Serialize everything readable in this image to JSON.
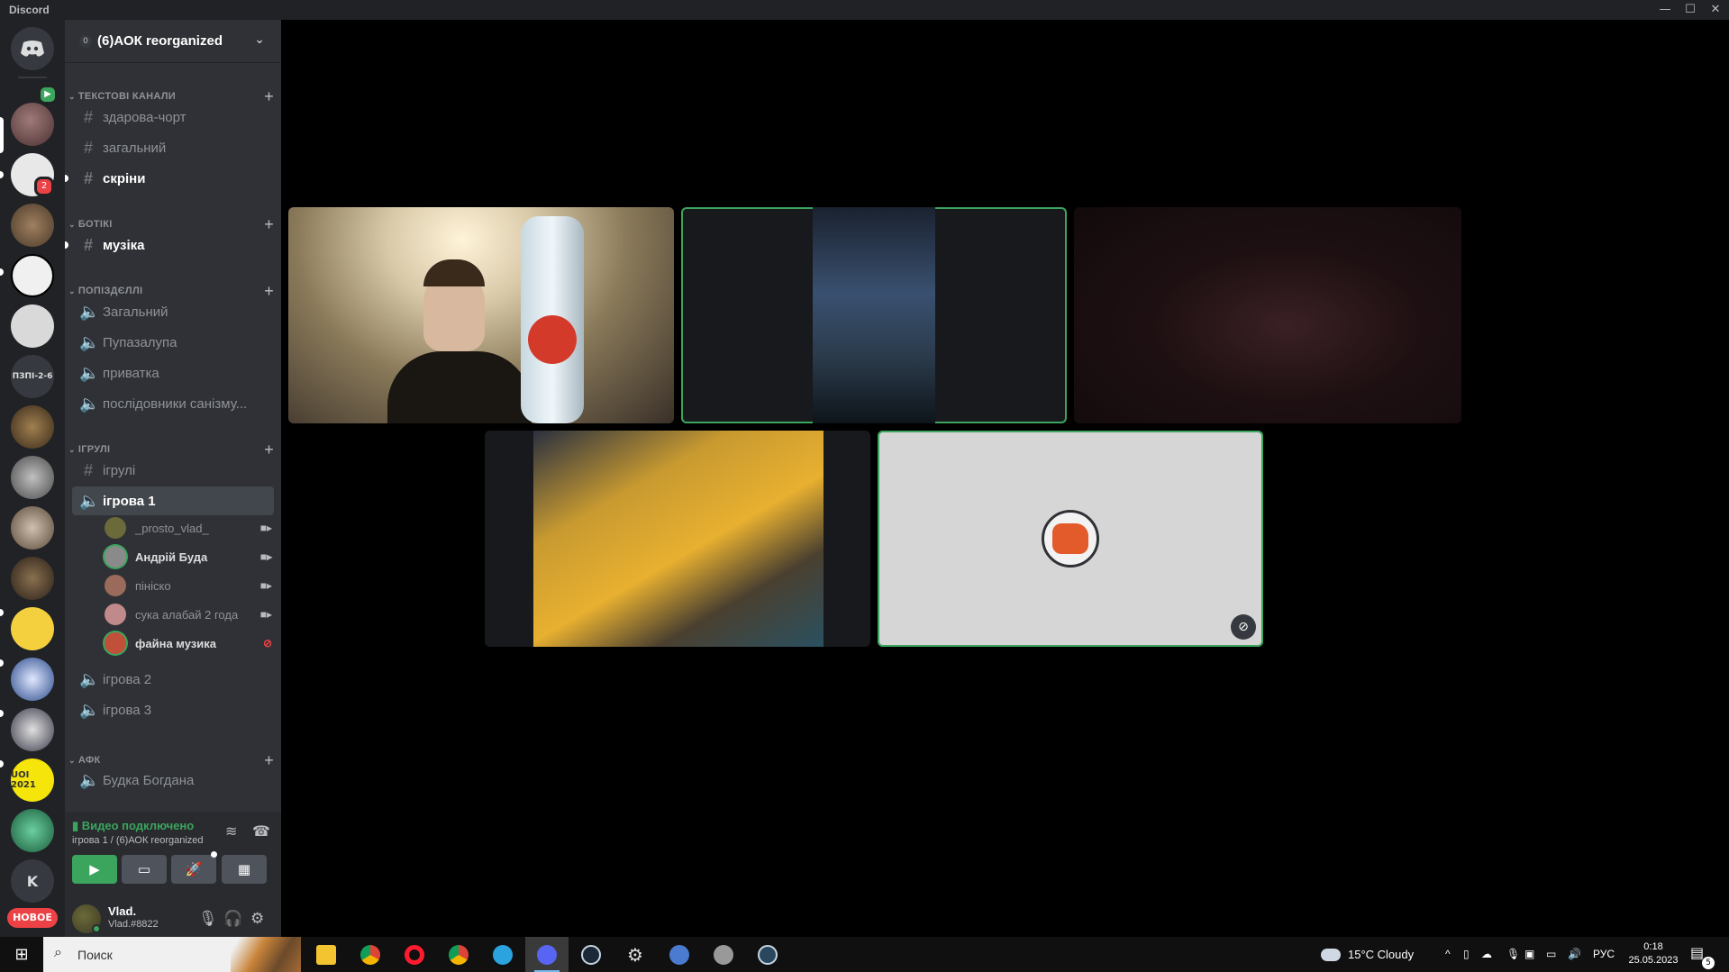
{
  "window": {
    "title": "Discord",
    "minimize": "—",
    "maximize": "☐",
    "close": "✕"
  },
  "guilds": {
    "home_icon": "discord-logo-icon",
    "items": [
      {
        "name": "server-1",
        "color": "#7a5a5a",
        "badge": ""
      },
      {
        "name": "server-2",
        "color": "#e8e8e8",
        "badge": "2"
      },
      {
        "name": "server-3",
        "color": "#7b6650",
        "badge": ""
      },
      {
        "name": "server-4",
        "color": "#f0f0f0",
        "badge": ""
      },
      {
        "name": "server-5",
        "color": "#d9d9d9",
        "badge": ""
      },
      {
        "name": "server-6",
        "text": "ПЗПІ-2-6",
        "color": "#36393f",
        "badge": ""
      },
      {
        "name": "server-7",
        "color": "#6b5a3a",
        "badge": ""
      },
      {
        "name": "server-8",
        "color": "#9a9a9a",
        "badge": ""
      },
      {
        "name": "server-9",
        "color": "#8a7a6a",
        "badge": ""
      },
      {
        "name": "server-10",
        "color": "#5a4a3a",
        "badge": ""
      },
      {
        "name": "server-11",
        "color": "#f4d03f",
        "badge": ""
      },
      {
        "name": "server-12",
        "color": "#2a4a8a",
        "badge": ""
      },
      {
        "name": "server-13",
        "color": "#5a5a6a",
        "badge": ""
      },
      {
        "name": "server-14",
        "text": "UOI 2021",
        "color": "#f5e50a",
        "badge": ""
      },
      {
        "name": "server-15",
        "color": "#2e7d5a",
        "badge": ""
      },
      {
        "name": "server-16",
        "text": "K",
        "color": "#36393f",
        "badge": ""
      }
    ],
    "new_label": "НОВОЕ"
  },
  "server": {
    "boost": "0",
    "name": "(6)АОК reorganized",
    "chevron": "⌄"
  },
  "categories": [
    {
      "label": "ТЕКСТОВІ КАНАЛИ"
    },
    {
      "label": "БОТІКІ"
    },
    {
      "label": "ПОПІЗДЄЛЛІ"
    },
    {
      "label": "ІГРУЛІ"
    },
    {
      "label": "АФК"
    }
  ],
  "channels": {
    "c1": "здарова-чорт",
    "c2": "загальний",
    "c3": "скріни",
    "c4": "музіка",
    "c5": "Загальний",
    "c6": "Пупазалупа",
    "c7": "приватка",
    "c8": "послідовники санізму...",
    "c9": "ігрулі",
    "c10": "ігрова 1",
    "c11": "ігрова 2",
    "c12": "ігрова 3",
    "c13": "Будка Богдана"
  },
  "voice_users": [
    {
      "name": "_prosto_vlad_",
      "color": "#6b6a3a"
    },
    {
      "name": "Андрій Буда",
      "color": "#8a8a8a"
    },
    {
      "name": "пініско",
      "color": "#9a6a5a"
    },
    {
      "name": "сука алабай 2 года",
      "color": "#c08a8a"
    },
    {
      "name": "файна музика",
      "color": "#c0503a"
    }
  ],
  "voice_panel": {
    "status": "Видео подключено",
    "sub": "ігрова 1 / (6)АОК reorganized"
  },
  "user": {
    "name": "Vlad.",
    "tag": "Vlad.#8822"
  },
  "taskbar": {
    "search_placeholder": "Поиск",
    "weather": "15°C  Cloudy",
    "lang": "РУС",
    "time": "0:18",
    "date": "25.05.2023",
    "notif_count": "5",
    "apps": [
      {
        "name": "file-explorer",
        "color": "#f4c430"
      },
      {
        "name": "chrome",
        "color": "#db4437"
      },
      {
        "name": "opera",
        "color": "#ff1b2d"
      },
      {
        "name": "chrome-2",
        "color": "#0f9d58"
      },
      {
        "name": "telegram",
        "color": "#2aa3df"
      },
      {
        "name": "discord",
        "color": "#5865f2"
      },
      {
        "name": "steam",
        "color": "#1b2838"
      },
      {
        "name": "settings",
        "color": "#cccccc"
      },
      {
        "name": "qbittorrent",
        "color": "#4a7bd0"
      },
      {
        "name": "app-grey",
        "color": "#999999"
      },
      {
        "name": "steam-2",
        "color": "#2a475e"
      }
    ]
  }
}
